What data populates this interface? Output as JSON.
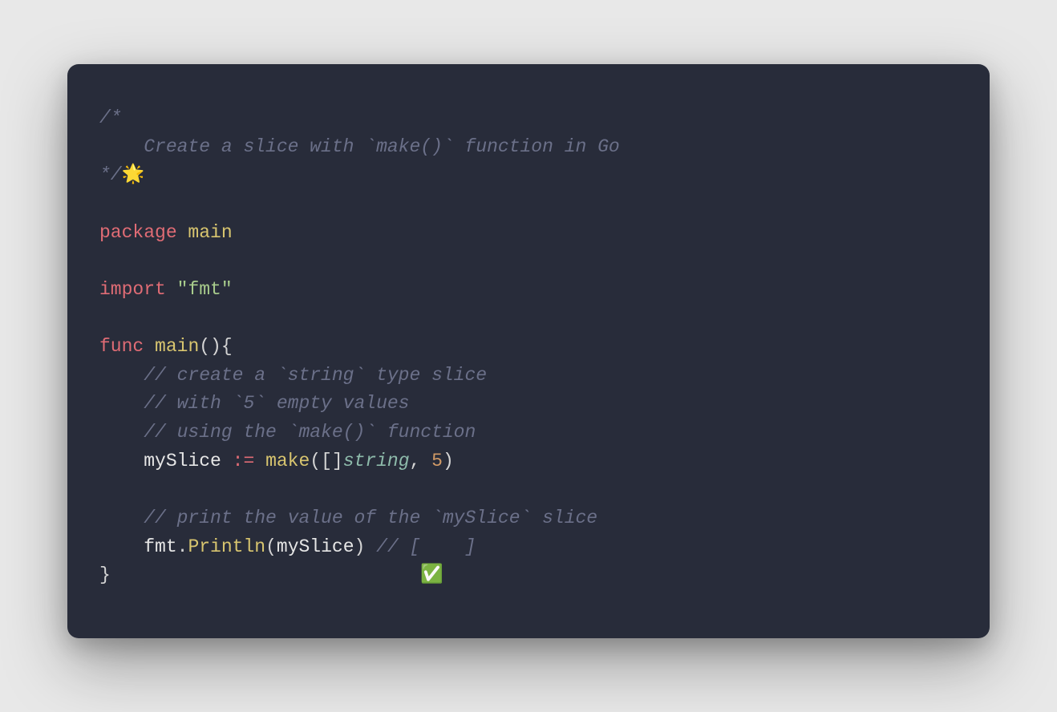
{
  "code": {
    "line1": "/*",
    "line2_indent": "    ",
    "line2_text": "Create a slice with `make()` function in Go",
    "line3": "*/",
    "line3_emoji": "🌟",
    "line4": "",
    "line5_kw": "package",
    "line5_pkg": " main",
    "line6": "",
    "line7_kw": "import",
    "line7_sp": " ",
    "line7_str": "\"fmt\"",
    "line8": "",
    "line9_kw": "func",
    "line9_sp": " ",
    "line9_name": "main",
    "line9_paren": "(){",
    "line10_indent": "    ",
    "line10_text": "// create a `string` type slice",
    "line11_indent": "    ",
    "line11_text": "// with `5` empty values",
    "line12_indent": "    ",
    "line12_text": "// using the `make()` function",
    "line13_indent": "    ",
    "line13_ident": "mySlice",
    "line13_sp1": " ",
    "line13_op": ":=",
    "line13_sp2": " ",
    "line13_make": "make",
    "line13_p1": "([]",
    "line13_type": "string",
    "line13_comma": ", ",
    "line13_num": "5",
    "line13_p2": ")",
    "line14": "",
    "line15_indent": "    ",
    "line15_text": "// print the value of the `mySlice` slice",
    "line16_indent": "    ",
    "line16_mod": "fmt",
    "line16_dot": ".",
    "line16_method": "Println",
    "line16_p1": "(",
    "line16_arg": "mySlice",
    "line16_p2": ")",
    "line16_sp": " ",
    "line16_comment": "// [    ]",
    "line17_close": "}",
    "line17_pad": "                            ",
    "line17_emoji": "✅"
  }
}
